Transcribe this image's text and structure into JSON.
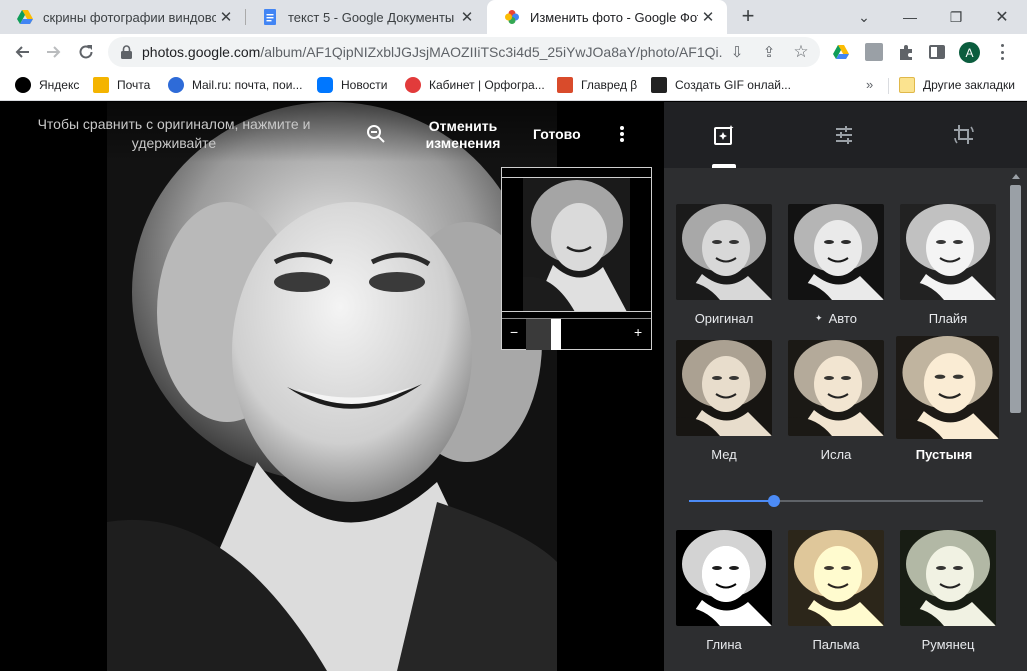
{
  "tabs": [
    {
      "title": "скрины фотографии виндовс – ",
      "icon": "google-drive-icon"
    },
    {
      "title": "текст 5 - Google Документы",
      "icon": "google-docs-icon"
    },
    {
      "title": "Изменить фото - Google Фото",
      "icon": "google-photos-icon",
      "active": true
    }
  ],
  "address_bar": {
    "domain": "photos.google.com",
    "path": "/album/AF1QipNIZxblJGJsjMAOZIIiTSc3i4d5_25iYwJOa8aY/photo/AF1Qi..."
  },
  "bookmarks": [
    {
      "label": "Яндекс",
      "icon": "yandex-icon",
      "color": "#000000"
    },
    {
      "label": "Почта",
      "icon": "mail-icon",
      "color": "#f4b400"
    },
    {
      "label": "Mail.ru: почта, пои...",
      "icon": "mailru-icon",
      "color": "#2e6bd8"
    },
    {
      "label": "Новости",
      "icon": "vk-icon",
      "color": "#0077ff"
    },
    {
      "label": "Кабинет | Орфогра...",
      "icon": "orfogrammka-icon",
      "color": "#e23b3b"
    },
    {
      "label": "Главред β",
      "icon": "glavred-icon",
      "color": "#d94b2b"
    },
    {
      "label": "Создать GIF онлай...",
      "icon": "gif-tool-icon",
      "color": "#222222"
    }
  ],
  "bookmarks_more": "»",
  "other_bookmarks": "Другие закладки",
  "account_initial": "A",
  "editor": {
    "compare_hint": "Чтобы сравнить с оригиналом, нажмите и удерживайте",
    "revert_label": "Отменить изменения",
    "done_label": "Готово",
    "navigator": {
      "minus": "−",
      "plus": "+",
      "zoom_level": 0.25
    }
  },
  "panel": {
    "tabs": [
      {
        "name": "filters",
        "icon": "photo-filter-icon",
        "active": true
      },
      {
        "name": "adjust",
        "icon": "tune-sliders-icon"
      },
      {
        "name": "crop-rotate",
        "icon": "crop-rotate-icon"
      }
    ],
    "filters": [
      {
        "label": "Оригинал",
        "tone": "original"
      },
      {
        "label": "Авто",
        "tone": "auto",
        "icon": "auto-sparkle-icon"
      },
      {
        "label": "Плайя",
        "tone": "playa"
      },
      {
        "label": "Мед",
        "tone": "honey"
      },
      {
        "label": "Исла",
        "tone": "isla"
      },
      {
        "label": "Пустыня",
        "tone": "desert",
        "selected": true
      },
      {
        "label": "Глина",
        "tone": "clay"
      },
      {
        "label": "Пальма",
        "tone": "palma"
      },
      {
        "label": "Румянец",
        "tone": "blush"
      }
    ],
    "intensity": 0.29
  },
  "colors": {
    "accent": "#4c8bf5",
    "panel_bg": "#2d2e30",
    "panel_header_bg": "#202124",
    "tabstrip_bg": "#dee1e6"
  }
}
